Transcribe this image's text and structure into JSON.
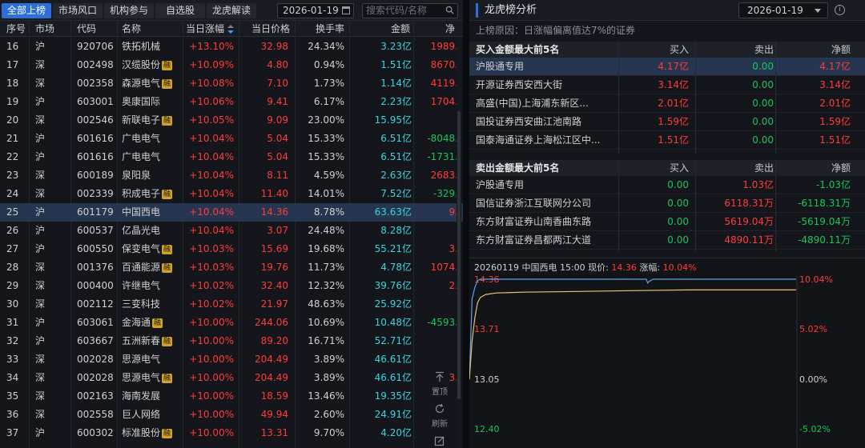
{
  "left": {
    "tabs": [
      "全部上榜",
      "市场风口",
      "机构参与",
      "自选股",
      "龙虎解读"
    ],
    "active_tab": 0,
    "date": "2026-01-19",
    "search_placeholder": "搜索代码/名称",
    "columns": [
      "序号",
      "市场",
      "代码",
      "名称",
      "当日涨幅",
      "当日价格",
      "换手率",
      "金额",
      "净"
    ],
    "rz_badge": "融",
    "rows": [
      {
        "idx": "16",
        "mkt": "沪",
        "code": "920706",
        "name": "铁拓机械",
        "rz": false,
        "chg": "+13.10%",
        "price": "32.98",
        "turn": "24.34%",
        "amt": "3.23亿",
        "net": "1989.",
        "net_color": "red"
      },
      {
        "idx": "17",
        "mkt": "深",
        "code": "002498",
        "name": "汉缆股份",
        "rz": true,
        "chg": "+10.09%",
        "price": "4.80",
        "turn": "0.94%",
        "amt": "1.51亿",
        "net": "8670.",
        "net_color": "red"
      },
      {
        "idx": "18",
        "mkt": "深",
        "code": "002358",
        "name": "森源电气",
        "rz": true,
        "chg": "+10.08%",
        "price": "7.10",
        "turn": "1.73%",
        "amt": "1.14亿",
        "net": "4119.",
        "net_color": "red"
      },
      {
        "idx": "19",
        "mkt": "沪",
        "code": "603001",
        "name": "奥康国际",
        "rz": false,
        "chg": "+10.06%",
        "price": "9.41",
        "turn": "6.17%",
        "amt": "2.23亿",
        "net": "1704.",
        "net_color": "red"
      },
      {
        "idx": "20",
        "mkt": "深",
        "code": "002546",
        "name": "新联电子",
        "rz": true,
        "chg": "+10.05%",
        "price": "9.09",
        "turn": "23.00%",
        "amt": "15.95亿",
        "net": "",
        "net_color": "red"
      },
      {
        "idx": "21",
        "mkt": "沪",
        "code": "601616",
        "name": "广电电气",
        "rz": false,
        "chg": "+10.04%",
        "price": "5.04",
        "turn": "15.33%",
        "amt": "6.51亿",
        "net": "-8048.",
        "net_color": "green"
      },
      {
        "idx": "22",
        "mkt": "沪",
        "code": "601616",
        "name": "广电电气",
        "rz": false,
        "chg": "+10.04%",
        "price": "5.04",
        "turn": "15.33%",
        "amt": "6.51亿",
        "net": "-1731.",
        "net_color": "green"
      },
      {
        "idx": "23",
        "mkt": "深",
        "code": "600189",
        "name": "泉阳泉",
        "rz": false,
        "chg": "+10.04%",
        "price": "8.11",
        "turn": "4.59%",
        "amt": "2.63亿",
        "net": "2683.",
        "net_color": "red"
      },
      {
        "idx": "24",
        "mkt": "深",
        "code": "002339",
        "name": "积成电子",
        "rz": true,
        "chg": "+10.04%",
        "price": "11.40",
        "turn": "14.01%",
        "amt": "7.52亿",
        "net": "-329.",
        "net_color": "green"
      },
      {
        "idx": "25",
        "mkt": "沪",
        "code": "601179",
        "name": "中国西电",
        "rz": false,
        "chg": "+10.04%",
        "price": "14.36",
        "turn": "8.78%",
        "amt": "63.63亿",
        "net": "9.",
        "net_color": "red",
        "selected": true
      },
      {
        "idx": "26",
        "mkt": "沪",
        "code": "600537",
        "name": "亿晶光电",
        "rz": false,
        "chg": "+10.04%",
        "price": "3.07",
        "turn": "24.48%",
        "amt": "8.28亿",
        "net": "",
        "net_color": "red"
      },
      {
        "idx": "27",
        "mkt": "沪",
        "code": "600550",
        "name": "保变电气",
        "rz": true,
        "chg": "+10.03%",
        "price": "15.69",
        "turn": "19.68%",
        "amt": "55.21亿",
        "net": "3.",
        "net_color": "red"
      },
      {
        "idx": "28",
        "mkt": "深",
        "code": "001376",
        "name": "百通能源",
        "rz": true,
        "chg": "+10.03%",
        "price": "19.76",
        "turn": "11.73%",
        "amt": "4.78亿",
        "net": "1074.",
        "net_color": "red"
      },
      {
        "idx": "29",
        "mkt": "深",
        "code": "000400",
        "name": "许继电气",
        "rz": false,
        "chg": "+10.02%",
        "price": "32.40",
        "turn": "12.32%",
        "amt": "39.76亿",
        "net": "2.",
        "net_color": "red"
      },
      {
        "idx": "30",
        "mkt": "深",
        "code": "002112",
        "name": "三变科技",
        "rz": false,
        "chg": "+10.02%",
        "price": "21.97",
        "turn": "48.63%",
        "amt": "25.92亿",
        "net": "",
        "net_color": "red"
      },
      {
        "idx": "31",
        "mkt": "沪",
        "code": "603061",
        "name": "金海通",
        "rz": true,
        "chg": "+10.00%",
        "price": "244.06",
        "turn": "10.69%",
        "amt": "10.48亿",
        "net": "-4593.",
        "net_color": "green"
      },
      {
        "idx": "32",
        "mkt": "沪",
        "code": "603667",
        "name": "五洲新春",
        "rz": true,
        "chg": "+10.00%",
        "price": "89.20",
        "turn": "16.71%",
        "amt": "52.71亿",
        "net": "",
        "net_color": "red"
      },
      {
        "idx": "33",
        "mkt": "深",
        "code": "002028",
        "name": "思源电气",
        "rz": false,
        "chg": "+10.00%",
        "price": "204.49",
        "turn": "3.89%",
        "amt": "46.61亿",
        "net": "",
        "net_color": "red"
      },
      {
        "idx": "34",
        "mkt": "深",
        "code": "002028",
        "name": "思源电气",
        "rz": true,
        "chg": "+10.00%",
        "price": "204.49",
        "turn": "3.89%",
        "amt": "46.61亿",
        "net": "3.",
        "net_color": "red"
      },
      {
        "idx": "35",
        "mkt": "深",
        "code": "002163",
        "name": "海南发展",
        "rz": false,
        "chg": "+10.00%",
        "price": "18.59",
        "turn": "13.46%",
        "amt": "19.35亿",
        "net": "",
        "net_color": "red"
      },
      {
        "idx": "36",
        "mkt": "深",
        "code": "002558",
        "name": "巨人网络",
        "rz": false,
        "chg": "+10.00%",
        "price": "49.94",
        "turn": "2.60%",
        "amt": "24.91亿",
        "net": "",
        "net_color": "red"
      },
      {
        "idx": "37",
        "mkt": "沪",
        "code": "600302",
        "name": "标准股份",
        "rz": true,
        "chg": "+10.00%",
        "price": "13.31",
        "turn": "9.70%",
        "amt": "4.20亿",
        "net": "",
        "net_color": "red"
      }
    ],
    "float_top": "置顶",
    "float_refresh": "刷新"
  },
  "right": {
    "title": "龙虎榜分析",
    "date": "2026-01-19",
    "reason": "上榜原因：日涨幅偏离值达7%的证券",
    "buy_table": {
      "title": "买入金额最大前5名",
      "headers": [
        "买入",
        "卖出",
        "净额"
      ],
      "rows": [
        {
          "name": "沪股通专用",
          "buy": "4.17亿",
          "sell": "0.00",
          "net": "4.17亿",
          "selected": true
        },
        {
          "name": "开源证券西安西大街",
          "buy": "3.14亿",
          "sell": "0.00",
          "net": "3.14亿"
        },
        {
          "name": "高盛(中国)上海浦东新区...",
          "buy": "2.01亿",
          "sell": "0.00",
          "net": "2.01亿"
        },
        {
          "name": "国投证券西安曲江池南路",
          "buy": "1.59亿",
          "sell": "0.00",
          "net": "1.59亿"
        },
        {
          "name": "国泰海通证券上海松江区中...",
          "buy": "1.51亿",
          "sell": "0.00",
          "net": "1.51亿"
        }
      ]
    },
    "sell_table": {
      "title": "卖出金额最大前5名",
      "headers": [
        "买入",
        "卖出",
        "净额"
      ],
      "rows": [
        {
          "name": "沪股通专用",
          "buy": "0.00",
          "sell": "1.03亿",
          "net": "-1.03亿"
        },
        {
          "name": "国信证券浙江互联网分公司",
          "buy": "0.00",
          "sell": "6118.31万",
          "net": "-6118.31万"
        },
        {
          "name": "东方财富证券山南香曲东路",
          "buy": "0.00",
          "sell": "5619.04万",
          "net": "-5619.04万"
        },
        {
          "name": "东方财富证券昌都两江大道",
          "buy": "0.00",
          "sell": "4890.11万",
          "net": "-4890.11万"
        }
      ]
    },
    "chart": {
      "title_prefix": "20260119 中国西电 15:00 现价:",
      "price": "14.36",
      "chg_label": "涨幅:",
      "chg": "10.04%",
      "y_left": [
        "14.36",
        "13.71",
        "13.05",
        "12.40"
      ],
      "y_right": [
        "10.04%",
        "5.02%",
        "0.00%",
        "-5.02%"
      ]
    }
  },
  "chart_data": {
    "type": "line",
    "title": "20260119 中国西电 15:00",
    "ylim": [
      12.14,
      14.36
    ],
    "yticks_left": [
      14.36,
      13.71,
      13.05,
      12.4
    ],
    "yticks_right": [
      "10.04%",
      "5.02%",
      "0.00%",
      "-5.02%"
    ],
    "prev_close": 13.05,
    "series": [
      {
        "x": [
          0,
          2,
          4,
          6,
          8,
          10,
          12,
          14,
          16,
          18,
          20,
          60,
          100,
          130,
          131,
          132,
          135,
          140,
          200,
          240
        ],
        "values": [
          13.05,
          14.1,
          14.25,
          14.34,
          14.36,
          14.36,
          14.36,
          14.36,
          14.36,
          14.36,
          14.36,
          14.36,
          14.36,
          14.36,
          14.31,
          14.33,
          14.36,
          14.36,
          14.36,
          14.36
        ],
        "color": "#5fa0e6"
      },
      {
        "x": [
          0,
          2,
          4,
          6,
          8,
          12,
          20,
          40,
          80,
          120,
          160,
          200,
          240
        ],
        "values": [
          13.05,
          13.55,
          13.85,
          14.05,
          14.12,
          14.16,
          14.18,
          14.19,
          14.2,
          14.21,
          14.22,
          14.22,
          14.22
        ],
        "color": "#e8c271"
      }
    ]
  }
}
